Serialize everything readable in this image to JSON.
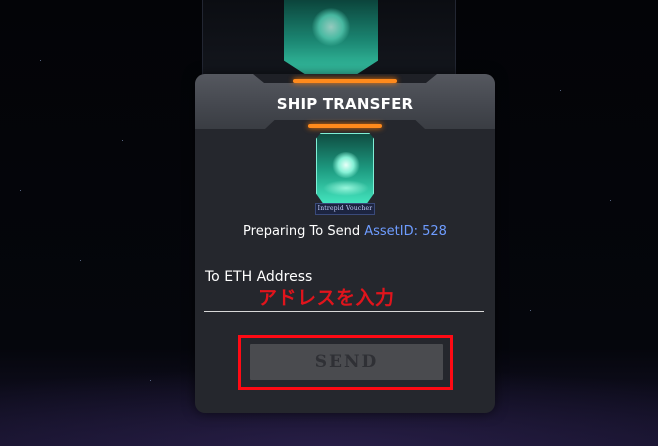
{
  "dialog": {
    "title": "SHIP TRANSFER",
    "voucher_label": "Intrepid Voucher",
    "preparing_text": "Preparing To Send",
    "asset_id": "AssetID: 528",
    "address_label": "To ETH Address",
    "address_value": "",
    "send_label": "SEND"
  },
  "annotations": {
    "address_hint": "アドレスを入力"
  },
  "colors": {
    "accent": "#ff8a1c",
    "asset_id": "#6e9cff",
    "annotation": "#e1141c",
    "voucher": "#3fe3bd"
  }
}
